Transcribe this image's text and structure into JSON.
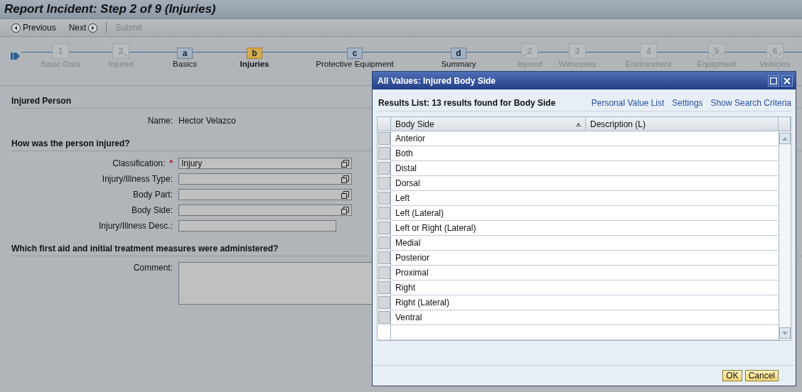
{
  "window": {
    "title": "Report Incident: Step 2 of 9 (Injuries)"
  },
  "toolbar": [
    {
      "label": "Previous",
      "kind": "back",
      "disabled": false
    },
    {
      "label": "Next",
      "kind": "forward",
      "disabled": false
    },
    {
      "label": "Submit",
      "kind": "plain",
      "disabled": true
    }
  ],
  "roadmap": [
    {
      "number": "1",
      "label": "Basic Data",
      "kind": "main",
      "selected": false,
      "arrow_left": false,
      "arrow_right": false
    },
    {
      "number": "2",
      "label": "Injured",
      "kind": "main",
      "selected": false,
      "arrow_left": false,
      "arrow_right": true
    },
    {
      "number": "a",
      "label": "Basics",
      "kind": "sub",
      "selected": false,
      "arrow_left": false,
      "arrow_right": false
    },
    {
      "number": "b",
      "label": "Injuries",
      "kind": "sub",
      "selected": true,
      "arrow_left": false,
      "arrow_right": false
    },
    {
      "number": "c",
      "label": "Protective Equipment",
      "kind": "sub",
      "selected": false,
      "arrow_left": false,
      "arrow_right": false
    },
    {
      "number": "d",
      "label": "Summary",
      "kind": "sub",
      "selected": false,
      "arrow_left": false,
      "arrow_right": false
    },
    {
      "number": "2",
      "label": "Injured",
      "kind": "main",
      "selected": false,
      "arrow_left": true,
      "arrow_right": false
    },
    {
      "number": "3",
      "label": "Witnesses",
      "kind": "main",
      "selected": false,
      "arrow_left": false,
      "arrow_right": false
    },
    {
      "number": "4",
      "label": "Environment",
      "kind": "main",
      "selected": false,
      "arrow_left": false,
      "arrow_right": false
    },
    {
      "number": "5",
      "label": "Equipment",
      "kind": "main",
      "selected": false,
      "arrow_left": true,
      "arrow_right": true
    },
    {
      "number": "6",
      "label": "Vehicles",
      "kind": "main",
      "selected": false,
      "arrow_left": true,
      "arrow_right": true
    }
  ],
  "sections": [
    {
      "title": "Injured Person",
      "rows": [
        {
          "label": "Name:",
          "kind": "text",
          "value": "Hector Velazco"
        }
      ]
    },
    {
      "title": "How was the person injured?",
      "rows": [
        {
          "label": "Classification:",
          "kind": "lookup",
          "value": "Injury",
          "mark": "*"
        },
        {
          "label": "Injury/Illness Type:",
          "kind": "lookup"
        },
        {
          "label": "Body Part:",
          "kind": "lookup"
        },
        {
          "label": "Body Side:",
          "kind": "lookup"
        },
        {
          "label": "Injury/Illness Desc.:",
          "kind": "input"
        }
      ]
    },
    {
      "title": "Which first aid and initial treatment measures were administered?",
      "rows": [
        {
          "label": "Comment:",
          "kind": "textarea"
        }
      ]
    }
  ],
  "dialog": {
    "title": "All Values: Injured Body Side",
    "results_title": "Results List: 13 results found for Body Side",
    "links": [
      "Personal Value List",
      "Settings",
      "Show Search Criteria"
    ],
    "columns": [
      "Body Side",
      "Description (L)"
    ],
    "rows": [
      "Anterior",
      "Both",
      "Distal",
      "Dorsal",
      "Left",
      "Left (Lateral)",
      "Left or Right (Lateral)",
      "Medial",
      "Posterior",
      "Proximal",
      "Right",
      "Right (Lateral)",
      "Ventral"
    ],
    "buttons": [
      "OK",
      "Cancel"
    ]
  }
}
